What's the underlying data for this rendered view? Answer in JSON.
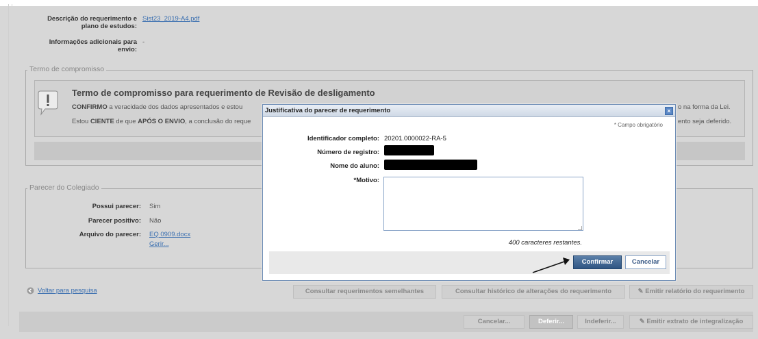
{
  "request": {
    "description_label": "Descrição do requerimento e plano de estudos:",
    "description_label_l1": "Descrição do requerimento e",
    "description_label_l2": "plano de estudos:",
    "description_file": "Sist23_2019-A4.pdf",
    "additional_label_l1": "Informações adicionais para",
    "additional_label_l2": "envio:",
    "additional_value": "-"
  },
  "commitment": {
    "legend": "Termo de compromisso",
    "title": "Termo de compromisso para requerimento de Revisão de desligamento",
    "line1_strong": "CONFIRMO",
    "line1_rest": " a veracidade dos dados apresentados e estou",
    "line1_tail": "o na forma da Lei.",
    "line2_pre": "Estou ",
    "line2_strong1": "CIENTE",
    "line2_mid": " de que ",
    "line2_strong2": "APÓS O ENVIO",
    "line2_rest": ", a conclusão do reque",
    "line2_tail": "ento seja deferido."
  },
  "board": {
    "legend": "Parecer do Colegiado",
    "has_opinion_label": "Possui parecer:",
    "has_opinion_value": "Sim",
    "positive_label": "Parecer positivo:",
    "positive_value": "Não",
    "file_label": "Arquivo do parecer:",
    "file_value": "EQ 0909.docx",
    "manage_link": "Gerir..."
  },
  "actions": {
    "back_link": "Voltar para pesquisa",
    "similar": "Consultar requerimentos semelhantes",
    "history": "Consultar histórico de alterações do requerimento",
    "report": "Emitir relatório do requerimento",
    "cancel": "Cancelar...",
    "approve": "Deferir...",
    "reject": "Indeferir...",
    "extract": "Emitir extrato de integralização"
  },
  "modal": {
    "title": "Justificativa do parecer de requerimento",
    "close": "×",
    "required_note": "* Campo obrigatório",
    "id_label": "Identificador completo:",
    "id_value": "20201.0000022-RA-5",
    "registration_label": "Número de registro:",
    "student_label": "Nome do aluno:",
    "reason_label": "*Motivo:",
    "reason_value": "",
    "remaining": "400 caracteres restantes.",
    "confirm": "Confirmar",
    "cancel": "Cancelar"
  }
}
